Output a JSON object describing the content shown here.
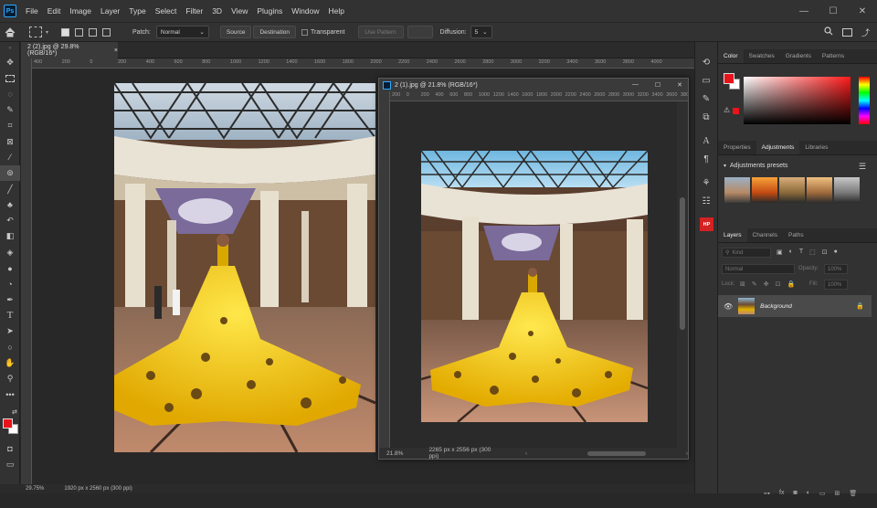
{
  "app": {
    "logo": "Ps"
  },
  "menu": [
    "File",
    "Edit",
    "Image",
    "Layer",
    "Type",
    "Select",
    "Filter",
    "3D",
    "View",
    "Plugins",
    "Window",
    "Help"
  ],
  "window_controls": {
    "minimize": "—",
    "maximize": "☐",
    "close": "✕"
  },
  "options": {
    "patch_label": "Patch:",
    "patch_value": "Normal",
    "source": "Source",
    "destination": "Destination",
    "transparent": "Transparent",
    "use_pattern": "Use Pattern",
    "diffusion_label": "Diffusion:",
    "diffusion_value": "5"
  },
  "doc1": {
    "tab_title": "2 (2).jpg @ 29.8% (RGB/16*)",
    "tab_close": "×",
    "ruler_h": [
      "400",
      "200",
      "0",
      "200",
      "400",
      "600",
      "800",
      "1000",
      "1200",
      "1400",
      "1600",
      "1800",
      "2000",
      "2200",
      "2400",
      "2600",
      "2800",
      "3000",
      "3200",
      "3400",
      "3600",
      "3800",
      "4000"
    ],
    "zoom": "29.75%",
    "size": "1920 px x 2560 px (300 ppi)"
  },
  "doc2": {
    "title": "2 (1).jpg @ 21.8% (RGB/16*)",
    "ruler_h": [
      "200",
      "0",
      "200",
      "400",
      "600",
      "800",
      "1000",
      "1200",
      "1400",
      "1600",
      "1800",
      "2000",
      "2200",
      "2400",
      "2600",
      "2800",
      "3000",
      "3200",
      "3400",
      "3600",
      "3800"
    ],
    "zoom": "21.8%",
    "size": "2265 px x 2556 px (300 ppi)"
  },
  "panels": {
    "color_tabs": [
      "Color",
      "Swatches",
      "Gradients",
      "Patterns"
    ],
    "props_tabs": [
      "Properties",
      "Adjustments",
      "Libraries"
    ],
    "adjustments_presets": "Adjustments presets",
    "layers_tabs": [
      "Layers",
      "Channels",
      "Paths"
    ],
    "kind": "Kind",
    "blend": "Normal",
    "opacity_label": "Opacity:",
    "opacity_value": "100%",
    "lock_label": "Lock:",
    "fill_label": "Fill:",
    "fill_value": "100%",
    "layer_name": "Background"
  },
  "colors": {
    "foreground": "#e8141b",
    "background": "#ffffff",
    "accent": "#31a8ff"
  }
}
